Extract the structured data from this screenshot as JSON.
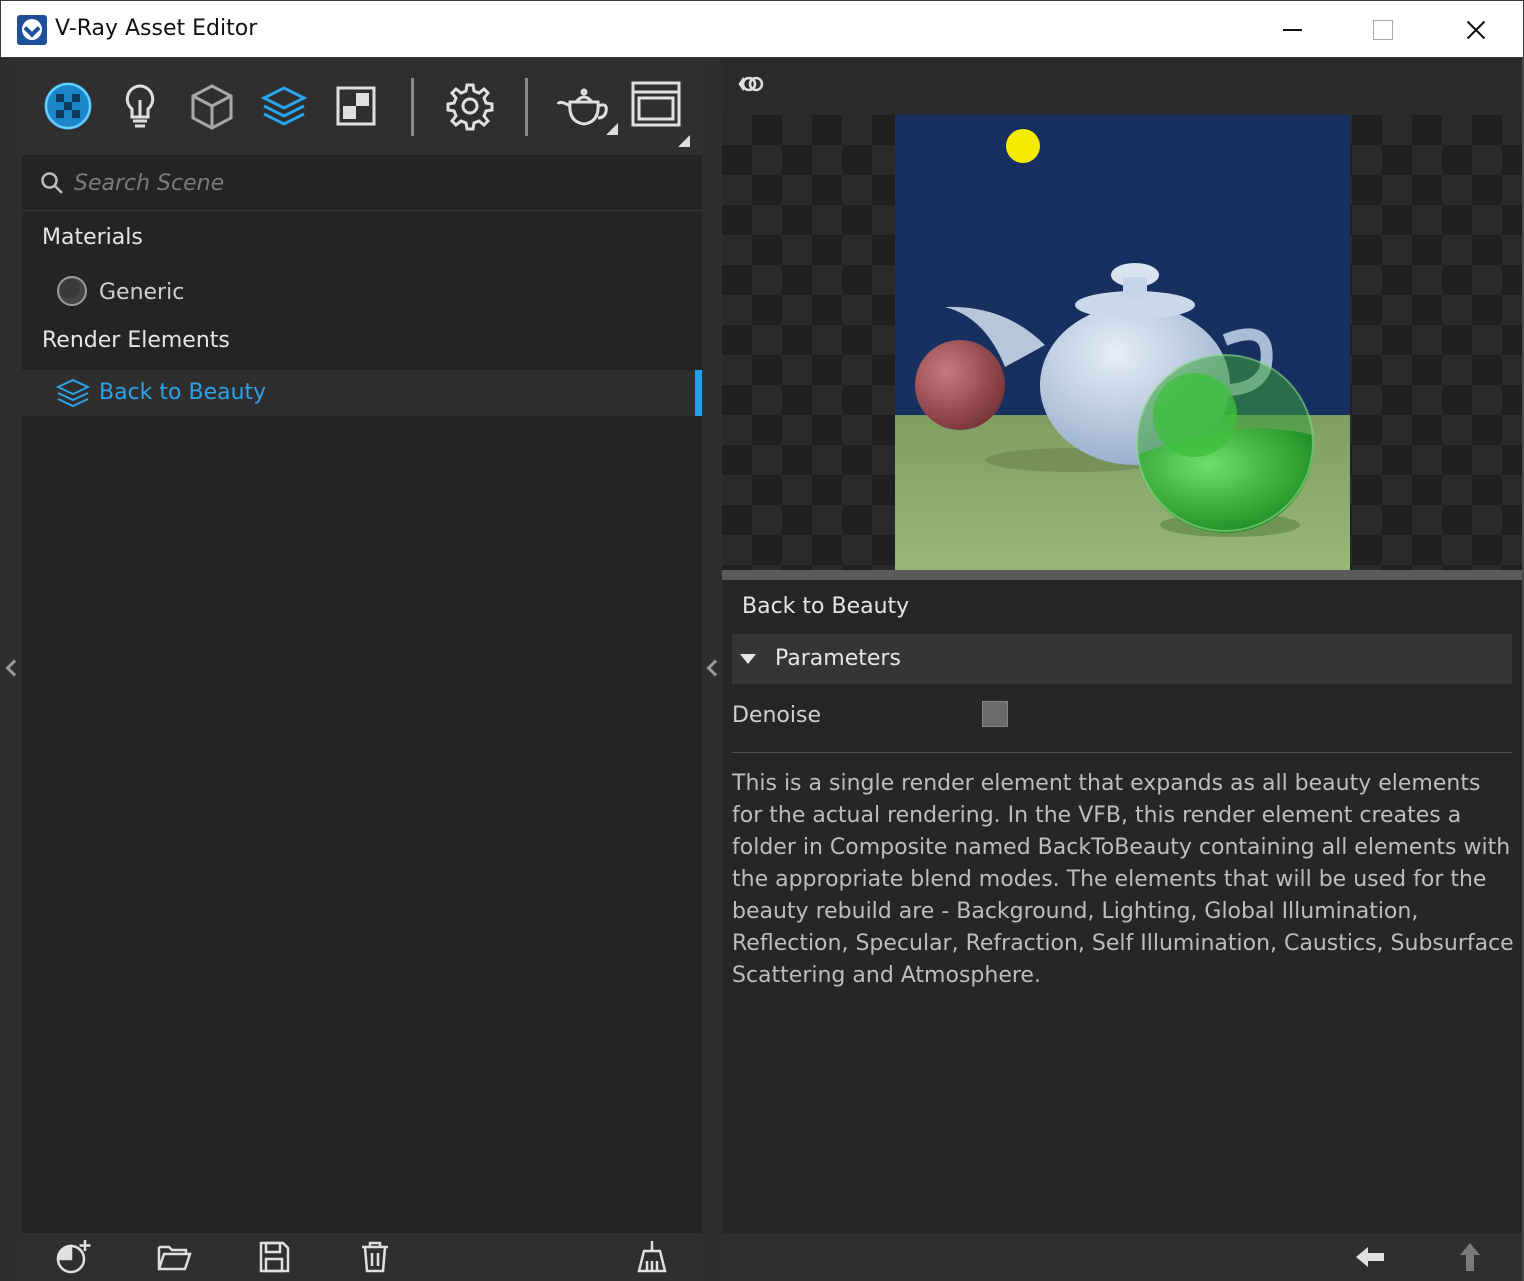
{
  "window": {
    "title": "V-Ray Asset Editor",
    "minimize_symbol": "—",
    "maximize_symbol": "□",
    "close_symbol": "✕"
  },
  "toolbar": {
    "items": [
      {
        "name": "materials-icon"
      },
      {
        "name": "lights-icon"
      },
      {
        "name": "geometry-icon"
      },
      {
        "name": "render-elements-icon",
        "active": true
      },
      {
        "name": "textures-icon"
      },
      {
        "name": "settings-icon"
      },
      {
        "name": "render-teapot-icon"
      },
      {
        "name": "frame-buffer-icon"
      }
    ],
    "accent": "#1ea1ea"
  },
  "search": {
    "placeholder": "Search Scene",
    "value": ""
  },
  "tree": {
    "materials_title": "Materials",
    "materials": [
      {
        "label": "Generic",
        "icon": "material-sphere-icon"
      }
    ],
    "render_elements_title": "Render Elements",
    "render_elements": [
      {
        "label": "Back to Beauty",
        "icon": "layers-icon",
        "selected": true
      }
    ]
  },
  "preview": {
    "toggle_icon": "preview-mode-icon"
  },
  "details": {
    "asset_name": "Back to Beauty",
    "section_label": "Parameters",
    "denoise_label": "Denoise",
    "denoise_checked": false,
    "description": "This is a single render element that expands as all beauty elements for the actual rendering. In the VFB, this render element creates a folder in Composite named BackToBeauty containing all elements with the appropriate blend modes. The elements that will be used for the beauty rebuild are - Background, Lighting, Global Illumination, Reflection, Specular, Refraction, Self Illumination, Caustics, Subsurface Scattering and Atmosphere."
  },
  "bottom_toolbar": {
    "left": [
      "add-asset-icon",
      "open-file-icon",
      "save-icon",
      "delete-icon",
      "purge-icon"
    ],
    "right": [
      "back-arrow-icon",
      "up-arrow-icon"
    ]
  }
}
